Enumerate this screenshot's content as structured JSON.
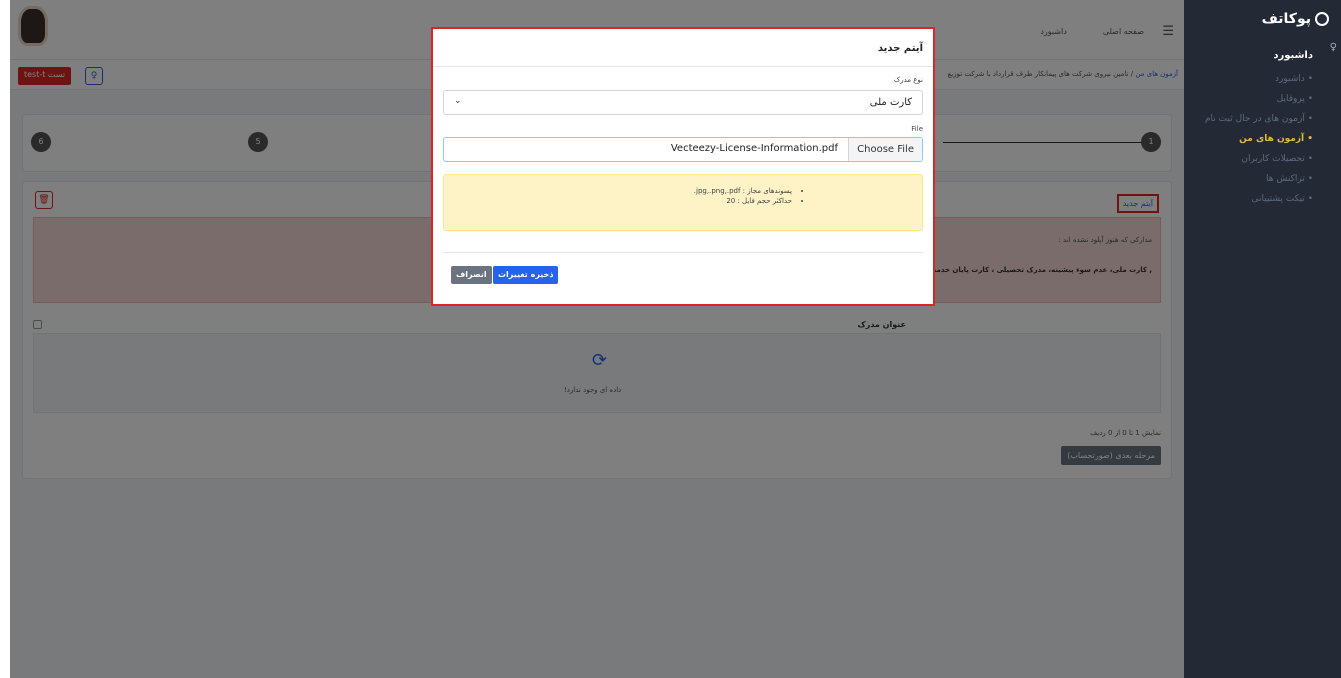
{
  "sidebar": {
    "brand": "پوکاتف",
    "section": "داشبورد",
    "items": [
      {
        "label": "داشبورد",
        "active": false
      },
      {
        "label": "پروفایل",
        "active": false
      },
      {
        "label": "آزمون های در حال ثبت نام",
        "active": false
      },
      {
        "label": "آزمون های من",
        "active": true
      },
      {
        "label": "تحصیلات کاربران",
        "active": false
      },
      {
        "label": "تراکنش ها",
        "active": false
      },
      {
        "label": "تیکت پشتیبانی",
        "active": false
      }
    ]
  },
  "topbar": {
    "nav": [
      "صفحه اصلی",
      "داشبورد"
    ],
    "breadcrumb_home": "آزمون های من",
    "breadcrumb_sep": "/",
    "breadcrumb_current": "تامین نیروی شرکت های پیمانکار طرف قرارداد با شرکت توزیع",
    "user_button": "تست test-t"
  },
  "stepper": {
    "steps": [
      "1",
      "5",
      "6"
    ]
  },
  "docs": {
    "new_item": "آیتم جدید",
    "alert_title": "مدارکی که هنوز آپلود نشده اند :",
    "alert_body": ", کارت ملی، عدم سوء پیشینه، مدرک تحصیلی ، کارت پایان خدمت ، عدم",
    "column_title": "عنوان مدرک",
    "empty": "داده ای وجود ندارد!",
    "showing": "نمایش 1 تا 0 از 0 ردیف",
    "next_button": "مرحله بعدی (صورتحساب)"
  },
  "modal": {
    "title": "آیتم جدید",
    "doc_type_label": "نوع مدرک",
    "doc_type_value": "کارت ملی",
    "file_label": "File",
    "choose_file": "Choose File",
    "file_name": "Vecteezy-License-Information.pdf",
    "info": [
      "پسوندهای مجاز : jpg,.png,.pdf.",
      "حداکثر حجم فایل : 20"
    ],
    "save": "ذخیره تغییرات",
    "cancel": "انصراف"
  }
}
